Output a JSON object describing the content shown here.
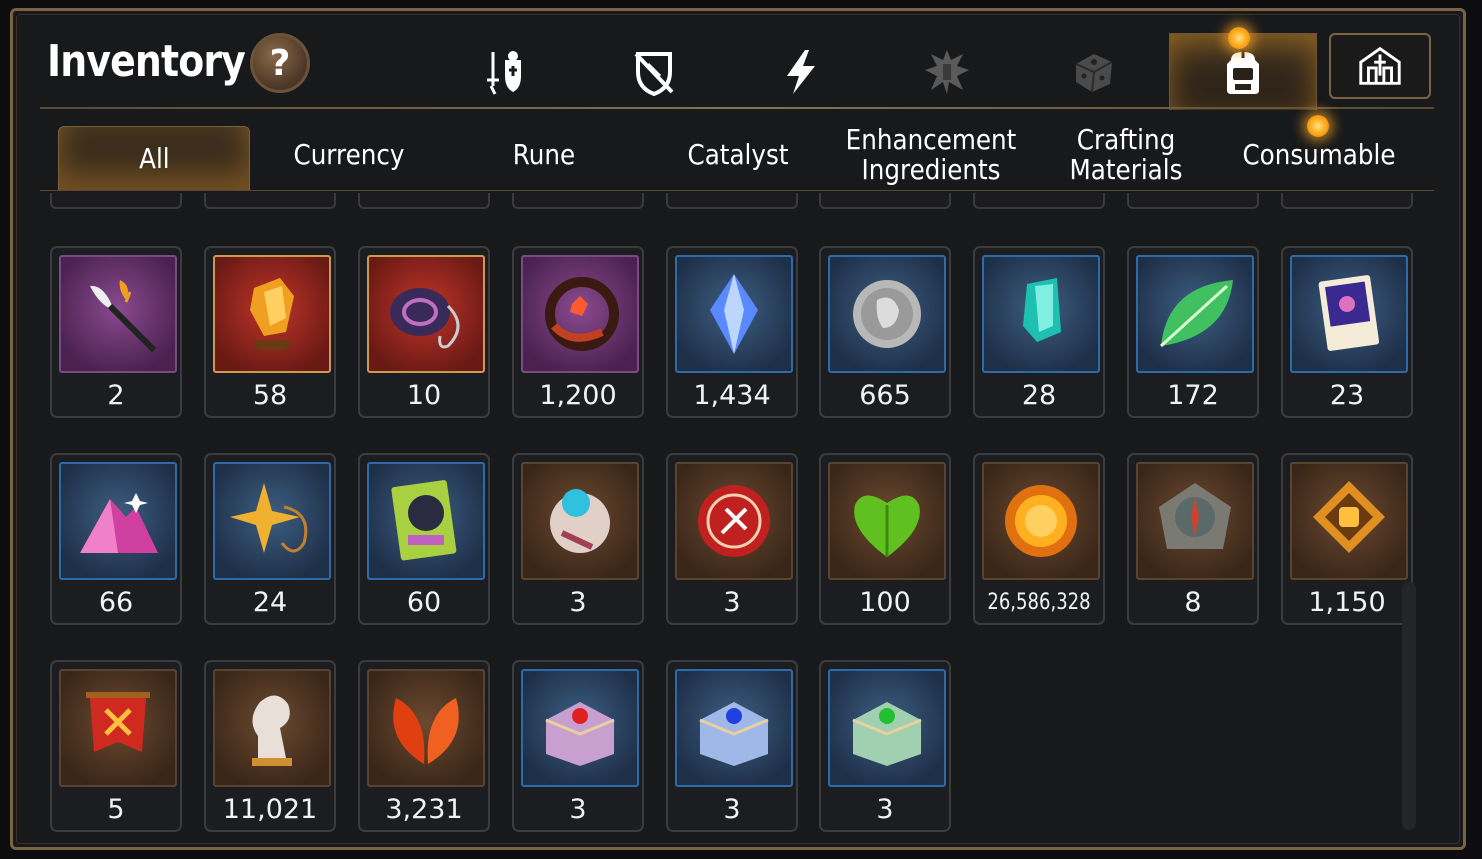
{
  "title": "Inventory",
  "help_label": "?",
  "top_tabs": [
    {
      "icon": "gear-weapon-armor-icon"
    },
    {
      "icon": "broken-shield-icon"
    },
    {
      "icon": "lightning-icon"
    },
    {
      "icon": "soldier-icon"
    },
    {
      "icon": "dice-icon"
    },
    {
      "icon": "backpack-icon",
      "active": true
    },
    {
      "icon": "guild-castle-icon"
    }
  ],
  "sub_tabs": {
    "all": "All",
    "currency": "Currency",
    "rune": "Rune",
    "catalyst": "Catalyst",
    "enhancement_1": "Enhancement",
    "enhancement_2": "Ingredients",
    "crafting_1": "Crafting",
    "crafting_2": "Materials",
    "consumable": "Consumable"
  },
  "items": [
    {
      "icon": "feather-wand-icon",
      "count": "2"
    },
    {
      "icon": "fire-crystal-icon",
      "count": "58"
    },
    {
      "icon": "ring-amulet-icon",
      "count": "10"
    },
    {
      "icon": "flame-ring-icon",
      "count": "1,200"
    },
    {
      "icon": "blue-gem-icon",
      "count": "1,434"
    },
    {
      "icon": "silver-coin-icon",
      "count": "665"
    },
    {
      "icon": "teal-crystal-icon",
      "count": "28"
    },
    {
      "icon": "green-leaf-icon",
      "count": "172"
    },
    {
      "icon": "paw-card-icon",
      "count": "23"
    },
    {
      "icon": "pink-crystal-pile-icon",
      "count": "66"
    },
    {
      "icon": "star-pendant-icon",
      "count": "24"
    },
    {
      "icon": "costume-card-icon",
      "count": "60"
    },
    {
      "icon": "orb-device-icon",
      "count": "3"
    },
    {
      "icon": "red-badge-icon",
      "count": "3"
    },
    {
      "icon": "green-heart-icon",
      "count": "100"
    },
    {
      "icon": "gold-sun-coin-icon",
      "count": "26,586,328"
    },
    {
      "icon": "stone-compass-icon",
      "count": "8"
    },
    {
      "icon": "fist-emblem-icon",
      "count": "1,150"
    },
    {
      "icon": "war-banner-icon",
      "count": "5"
    },
    {
      "icon": "chess-knight-icon",
      "count": "11,021"
    },
    {
      "icon": "red-leaves-icon",
      "count": "3,231"
    },
    {
      "icon": "red-gem-chest-icon",
      "count": "3"
    },
    {
      "icon": "blue-gem-chest-icon",
      "count": "3"
    },
    {
      "icon": "green-gem-chest-icon",
      "count": "3"
    }
  ]
}
